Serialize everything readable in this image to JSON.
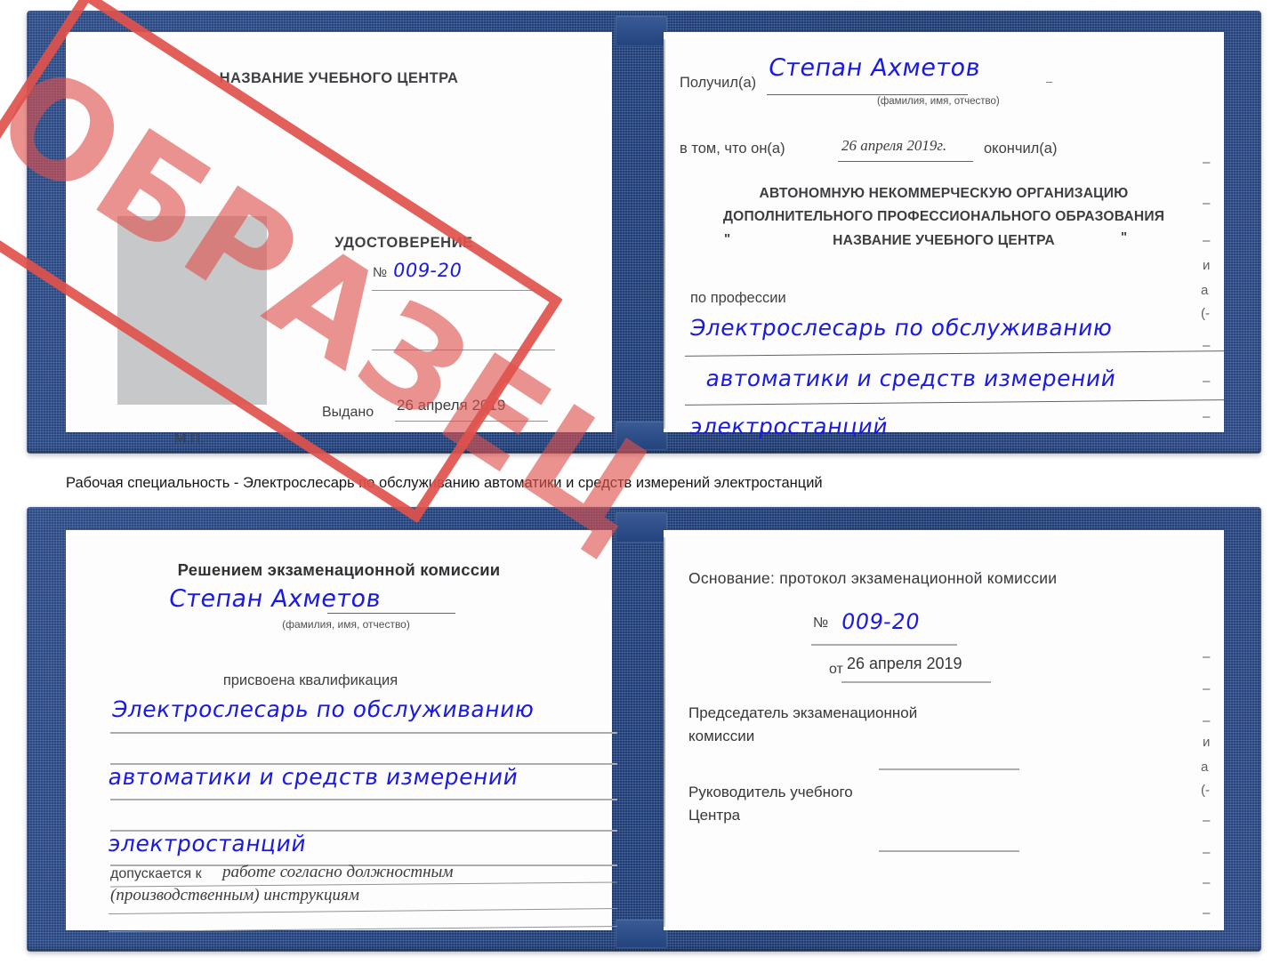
{
  "caption": "Рабочая специальность - Электрослесарь по обслуживанию автоматики и средств измерений электростанций",
  "stamp": {
    "text": "ОБРАЗЕЦ",
    "color": "#e0514c"
  },
  "ink_color": "#1a1ae0",
  "cover_color": "#20407c",
  "certificate_top": {
    "left_page": {
      "center_name": "НАЗВАНИЕ УЧЕБНОГО ЦЕНТРА",
      "doc_title": "УДОСТОВЕРЕНИЕ",
      "number_label": "№",
      "number_value": "009-20",
      "issued_label": "Выдано",
      "issued_value": "26 апреля 2019",
      "seal_label": "М.П."
    },
    "right_page": {
      "received_label": "Получил(а)",
      "received_value": "Степан Ахметов",
      "fio_hint": "(фамилия, имя, отчество)",
      "that_he_label": "в том, что он(а)",
      "finish_date_value": "26 апреля 2019г.",
      "graduated_label": "окончил(а)",
      "org_line1": "АВТОНОМНУЮ НЕКОММЕРЧЕСКУЮ ОРГАНИЗАЦИЮ",
      "org_line2": "ДОПОЛНИТЕЛЬНОГО ПРОФЕССИОНАЛЬНОГО ОБРАЗОВАНИЯ",
      "org_quote_open": "\"",
      "org_line3": "НАЗВАНИЕ УЧЕБНОГО ЦЕНТРА",
      "org_quote_close": "\"",
      "profession_label": "по профессии",
      "profession_line1": "Электрослесарь по обслуживанию",
      "profession_line2": "автоматики и средств измерений",
      "profession_line3": "электростанций"
    },
    "edge_fragments": [
      "–",
      "–",
      "–",
      "и",
      "а",
      "(-",
      "–",
      "–",
      "–"
    ]
  },
  "certificate_bottom": {
    "left_page": {
      "decision_title": "Решением экзаменационной комиссии",
      "name_value": "Степан Ахметов",
      "fio_hint": "(фамилия, имя, отчество)",
      "qualification_label": "присвоена квалификация",
      "qualification_line1": "Электрослесарь по обслуживанию",
      "qualification_line2": "автоматики и средств измерений",
      "qualification_line3": "электростанций",
      "admitted_label": "допускается к",
      "admitted_line1": "работе согласно должностным",
      "admitted_line2": "(производственным) инструкциям"
    },
    "right_page": {
      "basis_label": "Основание: протокол экзаменационной комиссии",
      "number_label": "№",
      "number_value": "009-20",
      "date_label": "от",
      "date_value": "26 апреля 2019",
      "chairman_line1": "Председатель экзаменационной",
      "chairman_line2": "комиссии",
      "head_line1": "Руководитель учебного",
      "head_line2": "Центра"
    },
    "edge_fragments": [
      "–",
      "–",
      "–",
      "и",
      "а",
      "(-",
      "–",
      "–",
      "–",
      "–"
    ]
  }
}
